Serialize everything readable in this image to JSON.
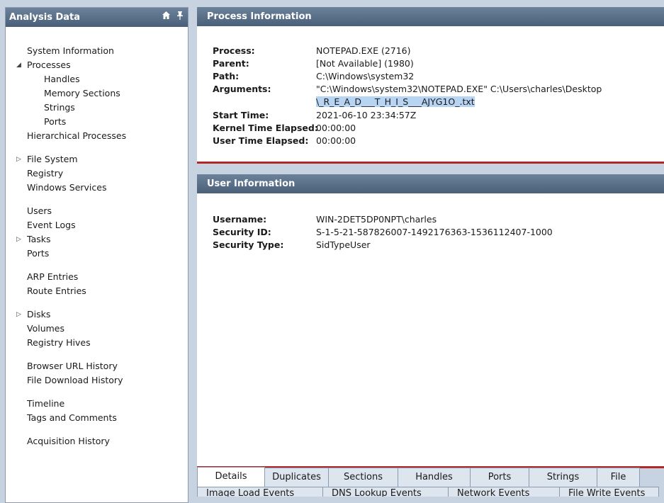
{
  "left": {
    "title": "Analysis Data",
    "icons": [
      "home-icon",
      "pin-icon"
    ],
    "items": [
      {
        "label": "System Information",
        "indent": 0,
        "arrow": ""
      },
      {
        "label": "Processes",
        "indent": 0,
        "arrow": "expanded"
      },
      {
        "label": "Handles",
        "indent": 1,
        "arrow": ""
      },
      {
        "label": "Memory Sections",
        "indent": 1,
        "arrow": ""
      },
      {
        "label": "Strings",
        "indent": 1,
        "arrow": ""
      },
      {
        "label": "Ports",
        "indent": 1,
        "arrow": ""
      },
      {
        "label": "Hierarchical Processes",
        "indent": 0,
        "arrow": ""
      },
      {
        "label": "File System",
        "indent": 0,
        "arrow": "collapsed"
      },
      {
        "label": "Registry",
        "indent": 0,
        "arrow": ""
      },
      {
        "label": "Windows Services",
        "indent": 0,
        "arrow": ""
      },
      {
        "label": "Users",
        "indent": 0,
        "arrow": ""
      },
      {
        "label": "Event Logs",
        "indent": 0,
        "arrow": ""
      },
      {
        "label": "Tasks",
        "indent": 0,
        "arrow": "collapsed"
      },
      {
        "label": "Ports",
        "indent": 0,
        "arrow": ""
      },
      {
        "label": "ARP Entries",
        "indent": 0,
        "arrow": ""
      },
      {
        "label": "Route Entries",
        "indent": 0,
        "arrow": ""
      },
      {
        "label": "Disks",
        "indent": 0,
        "arrow": "collapsed"
      },
      {
        "label": "Volumes",
        "indent": 0,
        "arrow": ""
      },
      {
        "label": "Registry Hives",
        "indent": 0,
        "arrow": ""
      },
      {
        "label": "Browser URL History",
        "indent": 0,
        "arrow": ""
      },
      {
        "label": "File Download History",
        "indent": 0,
        "arrow": ""
      },
      {
        "label": "Timeline",
        "indent": 0,
        "arrow": ""
      },
      {
        "label": "Tags and Comments",
        "indent": 0,
        "arrow": ""
      },
      {
        "label": "Acquisition History",
        "indent": 0,
        "arrow": ""
      }
    ]
  },
  "process": {
    "title": "Process Information",
    "rows": [
      {
        "key": "Process:",
        "value": "NOTEPAD.EXE (2716)"
      },
      {
        "key": "Parent:",
        "value": "[Not Available] (1980)"
      },
      {
        "key": "Path:",
        "value": "C:\\Windows\\system32"
      },
      {
        "key": "Arguments:",
        "value": "\"C:\\Windows\\system32\\NOTEPAD.EXE\" C:\\Users\\charles\\Desktop"
      },
      {
        "key": "",
        "value": "\\_R_E_A_D___T_H_I_S___AJYG1O_.txt"
      },
      {
        "key": "Start Time:",
        "value": "2021-06-10 23:34:57Z"
      },
      {
        "key": "Kernel Time Elapsed:",
        "value": "00:00:00"
      },
      {
        "key": "User Time Elapsed:",
        "value": "00:00:00"
      }
    ]
  },
  "user": {
    "title": "User Information",
    "rows": [
      {
        "key": "Username:",
        "value": "WIN-2DET5DP0NPT\\charles"
      },
      {
        "key": "Security ID:",
        "value": "S-1-5-21-587826007-1492176363-1536112407-1000"
      },
      {
        "key": "Security Type:",
        "value": "SidTypeUser"
      }
    ]
  },
  "tabs": [
    "Details",
    "Duplicates",
    "Sections",
    "Handles",
    "Ports",
    "Strings",
    "File"
  ],
  "active_tab": "Details",
  "tabs_row2": [
    "Image Load Events",
    "DNS Lookup Events",
    "Network Events",
    "File Write Events"
  ],
  "colors": {
    "header": "#5a6e87",
    "accent_line": "#b02828",
    "selection": "#b7d4f2"
  }
}
